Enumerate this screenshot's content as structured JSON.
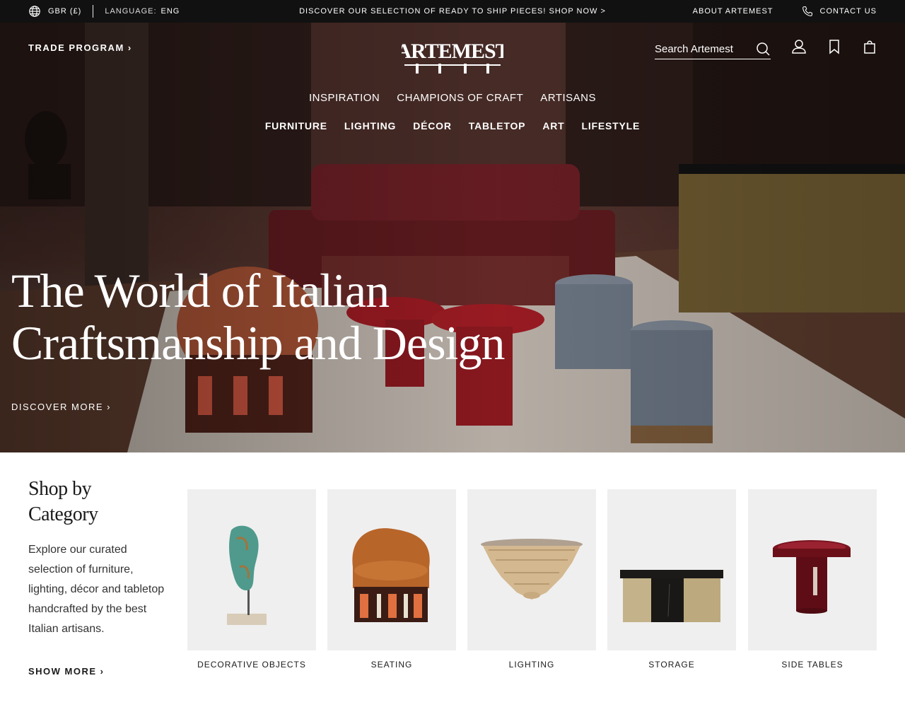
{
  "topbar": {
    "currency": "GBR (£)",
    "language_label": "LANGUAGE:",
    "language_value": "ENG",
    "promo": "DISCOVER OUR SELECTION OF READY TO SHIP PIECES! SHOP NOW >",
    "about": "ABOUT ARTEMEST",
    "contact": "CONTACT US"
  },
  "header": {
    "trade": "TRADE PROGRAM ›",
    "logo_text": "ARTEMEST",
    "search_placeholder": "Search Artemest"
  },
  "nav_primary": [
    "INSPIRATION",
    "CHAMPIONS OF CRAFT",
    "ARTISANS"
  ],
  "nav_secondary": [
    "FURNITURE",
    "LIGHTING",
    "DÉCOR",
    "TABLETOP",
    "ART",
    "LIFESTYLE"
  ],
  "hero": {
    "line1": "The World of Italian",
    "line2": "Craftsmanship and Design",
    "cta": "DISCOVER MORE ›"
  },
  "shop": {
    "title_line1": "Shop by",
    "title_line2": "Category",
    "description": "Explore our curated selection of furniture, lighting, décor and tabletop handcrafted by the best Italian artisans.",
    "show_more": "SHOW MORE ›",
    "categories": [
      {
        "label": "DECORATIVE OBJECTS",
        "icon": "sculpture-image"
      },
      {
        "label": "SEATING",
        "icon": "armchair-image"
      },
      {
        "label": "LIGHTING",
        "icon": "chandelier-image"
      },
      {
        "label": "STORAGE",
        "icon": "sideboard-image"
      },
      {
        "label": "SIDE TABLES",
        "icon": "side-table-image"
      }
    ]
  },
  "colors": {
    "topbar_bg": "#111111",
    "text_white": "#ffffff",
    "card_bg": "#efefef"
  }
}
